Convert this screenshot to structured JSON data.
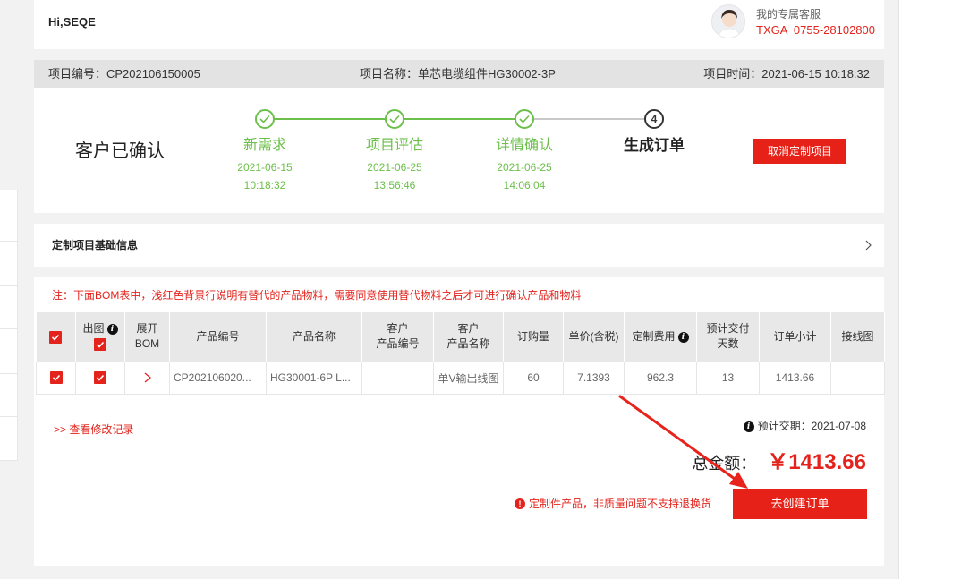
{
  "header": {
    "greeting": "Hi,SEQE",
    "service_label": "我的专属客服",
    "service_contact": "TXGA  0755-28102800"
  },
  "project_bar": {
    "number": "项目编号：CP202106150005",
    "name": "项目名称：单芯电缆组件HG30002-3P",
    "time": "项目时间：2021-06-15 10:18:32"
  },
  "status": {
    "title": "客户已确认",
    "steps": [
      {
        "label": "新需求",
        "date": "2021-06-15",
        "time": "10:18:32",
        "done": true
      },
      {
        "label": "项目评估",
        "date": "2021-06-25",
        "time": "13:56:46",
        "done": true
      },
      {
        "label": "详情确认",
        "date": "2021-06-25",
        "time": "14:06:04",
        "done": true
      },
      {
        "label": "生成订单",
        "number": "4",
        "done": false
      }
    ],
    "cancel_label": "取消定制项目"
  },
  "basic_info": {
    "title": "定制项目基础信息"
  },
  "bom": {
    "note": "注：下面BOM表中，浅红色背景行说明有替代的产品物料，需要同意使用替代物料之后才可进行确认产品和物料",
    "headers": [
      {
        "line1": "出图"
      },
      {
        "line1": "展开",
        "line2": "BOM"
      },
      {
        "line1": "产品编号"
      },
      {
        "line1": "产品名称"
      },
      {
        "line1": "客户",
        "line2": "产品编号"
      },
      {
        "line1": "客户",
        "line2": "产品名称"
      },
      {
        "line1": "订购量"
      },
      {
        "line1": "单价(含税)"
      },
      {
        "line1": "定制费用"
      },
      {
        "line1": "预计交付",
        "line2": "天数"
      },
      {
        "line1": "订单小计"
      },
      {
        "line1": "接线图"
      }
    ],
    "rows": [
      {
        "selected": true,
        "export_drawing": true,
        "product_code": "CP202106020...",
        "product_name": "HG30001-6P L...",
        "customer_product_name": "单V输出线图",
        "quantity": "60",
        "unit_price": "7.1393",
        "custom_fee": "962.3",
        "delivery_days": "13",
        "subtotal": "1413.66"
      }
    ]
  },
  "footer": {
    "history_link": ">> 查看修改记录",
    "delivery": "预计交期：2021-07-08",
    "total_label": "总金额：",
    "total_value": "￥1413.66",
    "warning": "定制件产品，非质量问题不支持退换货",
    "create_label": "去创建订单"
  },
  "icons": {
    "step_done": "check-circle-icon",
    "info": "info-icon",
    "warning": "warning-icon",
    "expand": "chevron-right-icon"
  },
  "colors": {
    "accent_red": "#e4231c",
    "button_red": "#e62117",
    "step_green": "#6cbf4a",
    "step_pending": "#333333"
  }
}
